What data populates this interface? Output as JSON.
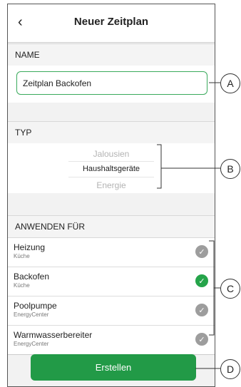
{
  "header": {
    "back_icon": "‹",
    "title": "Neuer Zeitplan"
  },
  "name_section": {
    "label": "NAME",
    "value": "Zeitplan Backofen"
  },
  "type_section": {
    "label": "TYP",
    "options": [
      "Jalousien",
      "Haushaltsgeräte",
      "Energie"
    ],
    "selected": "Haushaltsgeräte"
  },
  "apply_section": {
    "label": "ANWENDEN FÜR",
    "items": [
      {
        "name": "Heizung",
        "sub": "Küche",
        "checked": false
      },
      {
        "name": "Backofen",
        "sub": "Küche",
        "checked": true
      },
      {
        "name": "Poolpumpe",
        "sub": "EnergyCenter",
        "checked": false
      },
      {
        "name": "Warmwasserbereiter",
        "sub": "EnergyCenter",
        "checked": false
      }
    ]
  },
  "create_button": {
    "label": "Erstellen"
  },
  "callouts": [
    "A",
    "B",
    "C",
    "D"
  ],
  "colors": {
    "accent": "#229a47",
    "check_on": "#25a44a",
    "check_off": "#9d9d9d"
  }
}
